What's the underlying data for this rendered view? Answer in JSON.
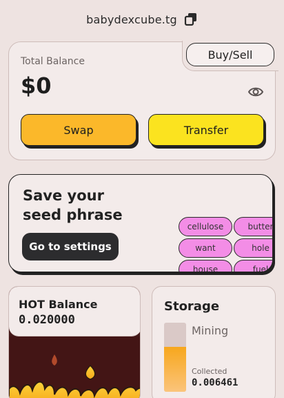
{
  "header": {
    "address": "babydexcube.tg",
    "copy_icon": "copy-icon"
  },
  "balance": {
    "label": "Total Balance",
    "value": "$0",
    "eye_icon": "eye-icon",
    "buy_sell_label": "Buy/Sell",
    "swap_label": "Swap",
    "transfer_label": "Transfer"
  },
  "seed": {
    "title": "Save your seed phrase",
    "settings_label": "Go to settings",
    "words": [
      "cellulose",
      "butter",
      "want",
      "hole",
      "house",
      "fuel"
    ]
  },
  "hot": {
    "label": "HOT Balance",
    "value": "0.020000"
  },
  "storage": {
    "title": "Storage",
    "mining_label": "Mining",
    "collected_label": "Collected",
    "collected_value": "0.006461",
    "fill_fraction": 0.65
  },
  "colors": {
    "background": "#eee3e1",
    "swap": "#fbb82a",
    "transfer": "#fbe31f",
    "chip": "#f38de6",
    "storage_fill": "#f7a71d"
  }
}
